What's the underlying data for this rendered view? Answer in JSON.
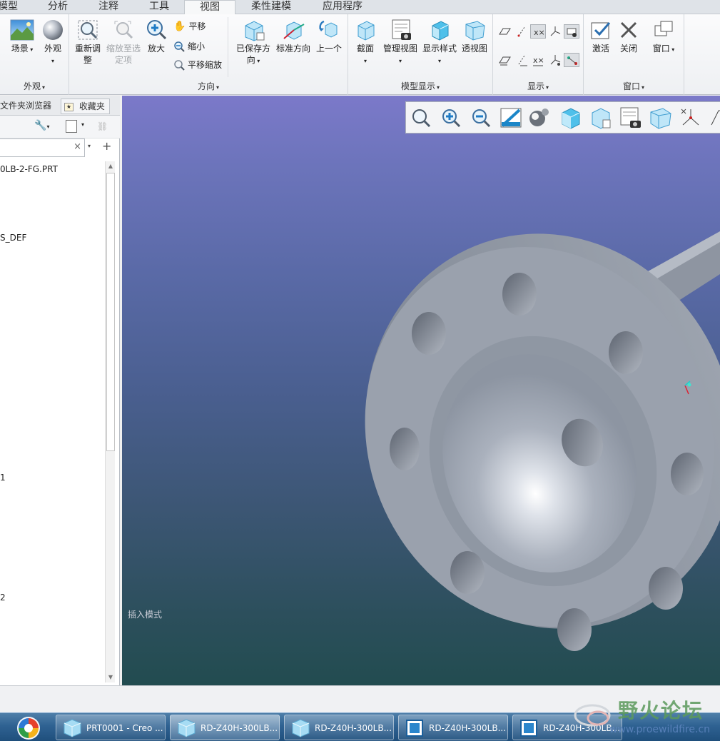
{
  "tabs": [
    {
      "label": "模型"
    },
    {
      "label": "分析"
    },
    {
      "label": "注释"
    },
    {
      "label": "工具"
    },
    {
      "label": "视图"
    },
    {
      "label": "柔性建模"
    },
    {
      "label": "应用程序"
    }
  ],
  "ribbon": {
    "appearance": {
      "group_label": "外观",
      "scene": "场景",
      "appearance": "外观"
    },
    "orientation": {
      "group_label": "方向",
      "refit_line1": "重新调",
      "refit_line2": "整",
      "zoom_sel_line1": "缩放至选",
      "zoom_sel_line2": "定项",
      "zoom_in": "放大",
      "pan": "平移",
      "zoom_out": "缩小",
      "pan_zoom": "平移缩放",
      "saved_line1": "已保存方",
      "saved_line2": "向",
      "standard": "标准方向",
      "previous": "上一个"
    },
    "model_display": {
      "group_label": "模型显示",
      "section": "截面",
      "manage_views": "管理视图",
      "display_style": "显示样式",
      "perspective": "透视图"
    },
    "show": {
      "group_label": "显示"
    },
    "window": {
      "group_label": "窗口",
      "activate": "激活",
      "close": "关闭",
      "windows": "窗口"
    }
  },
  "left_panel": {
    "tabs": {
      "folder_browser": "文件夹浏览器",
      "favorites": "收藏夹"
    },
    "search": {
      "value": ""
    },
    "tree": {
      "item1": "0LB-2-FG.PRT",
      "item2": "S_DEF",
      "item3": "1",
      "item4": "2"
    }
  },
  "viewport": {
    "mode_text": "插入模式"
  },
  "taskbar": {
    "tasks": [
      {
        "label": "PRT0001 - Creo ..."
      },
      {
        "label": "RD-Z40H-300LB..."
      },
      {
        "label": "RD-Z40H-300LB..."
      },
      {
        "label": "RD-Z40H-300LB..."
      },
      {
        "label": "RD-Z40H-300LB..."
      }
    ]
  },
  "watermark": {
    "title": "野火论坛",
    "url": "www.proewildfire.cn"
  },
  "colors": {
    "accent_blue": "#2f6292",
    "viewport_top": "#7b79c9",
    "viewport_bottom": "#224c50",
    "model_gray": "#9aa1ad"
  }
}
